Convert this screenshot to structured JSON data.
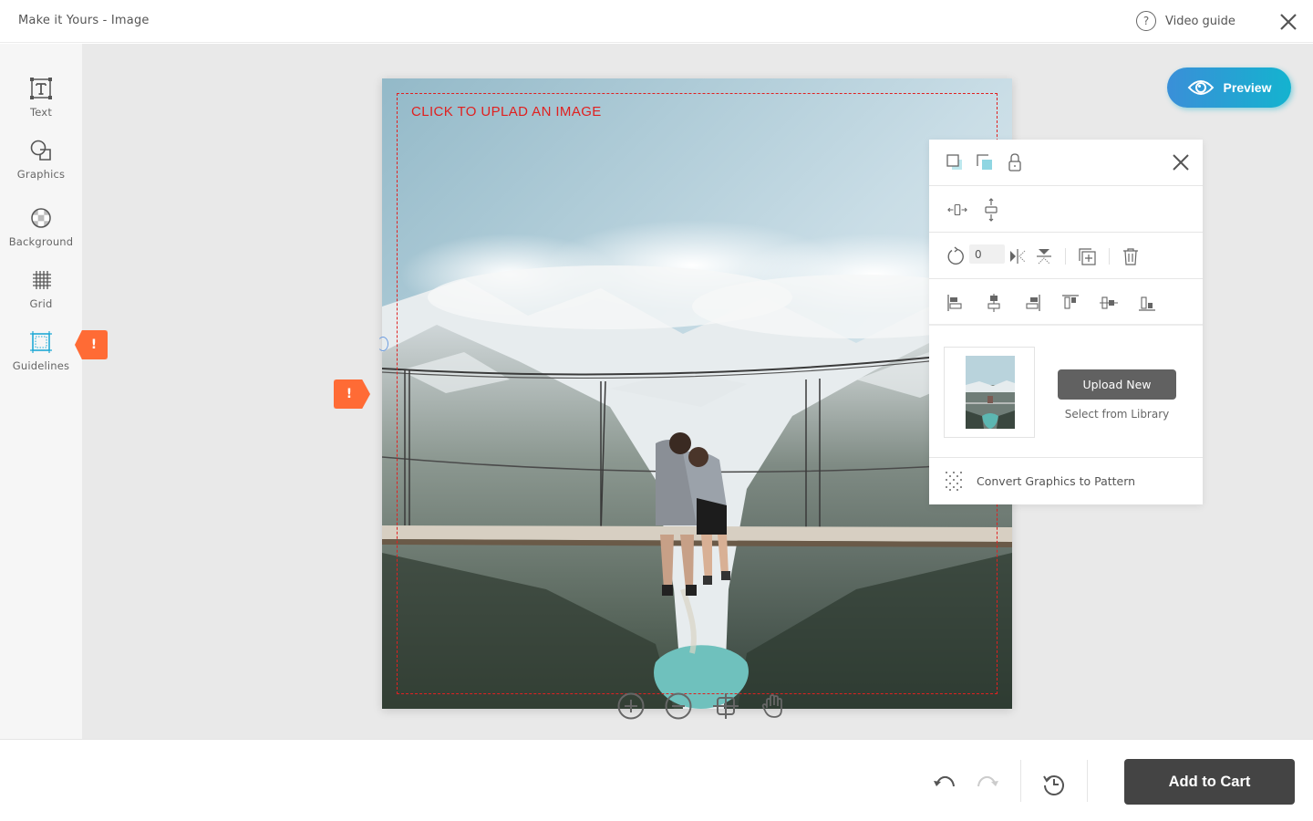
{
  "header": {
    "title": "Make it Yours - Image",
    "video_guide_label": "Video guide"
  },
  "sidebar": {
    "items": [
      {
        "label": "Text",
        "icon": "text-icon",
        "active": false
      },
      {
        "label": "Graphics",
        "icon": "shapes-icon",
        "active": false
      },
      {
        "label": "Background",
        "icon": "background-icon",
        "active": false
      },
      {
        "label": "Grid",
        "icon": "grid-icon",
        "active": false
      },
      {
        "label": "Guidelines",
        "icon": "guidelines-icon",
        "active": true
      }
    ],
    "warning_badge": "!"
  },
  "canvas": {
    "upload_hint": "CLICK TO UPLAD AN IMAGE",
    "warning_badge": "!",
    "image_description": "Couple sitting on a suspension bridge over a mountain valley with a turquoise lake"
  },
  "zoom_controls": [
    "zoom-in-icon",
    "zoom-out-icon",
    "fit-icon",
    "pan-hand-icon"
  ],
  "preview_button": {
    "label": "Preview",
    "icon": "eye-icon"
  },
  "panel": {
    "top_icons": [
      "bring-forward-icon",
      "send-backward-icon",
      "lock-icon"
    ],
    "resize_icons": [
      "stretch-horizontal-icon",
      "stretch-vertical-icon"
    ],
    "rotation_value": "0",
    "transform_icons": [
      "rotate-icon",
      "flip-horizontal-icon",
      "flip-vertical-icon",
      "duplicate-icon",
      "delete-icon"
    ],
    "align_icons": [
      "align-left-icon",
      "align-center-horizontal-icon",
      "align-right-icon",
      "align-top-icon",
      "align-middle-vertical-icon",
      "align-bottom-icon"
    ],
    "upload_new_label": "Upload New",
    "select_library_label": "Select from Library",
    "convert_pattern_label": "Convert Graphics to Pattern"
  },
  "footer": {
    "add_to_cart_label": "Add to Cart",
    "icons": [
      "undo-icon",
      "redo-icon",
      "history-icon"
    ]
  },
  "colors": {
    "accent_gradient_start": "#3a8fd8",
    "accent_gradient_end": "#14b3cf",
    "warning": "#ff6b35",
    "upload_hint": "#e0201f",
    "guideline_active": "#1fa9d6",
    "primary_button": "#444444"
  }
}
